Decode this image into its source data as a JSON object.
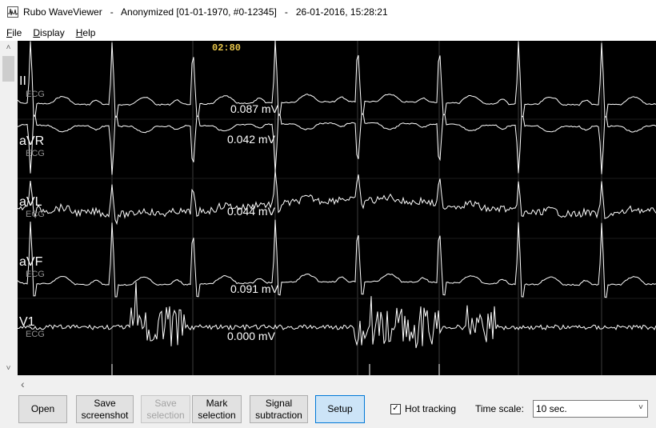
{
  "window": {
    "title": "Rubo WaveViewer   -   Anonymized [01-01-1970, #0-12345]   -   26-01-2016, 15:28:21"
  },
  "menu": {
    "items": [
      {
        "key": "F",
        "rest": "ile"
      },
      {
        "key": "D",
        "rest": "isplay"
      },
      {
        "key": "H",
        "rest": "elp"
      }
    ]
  },
  "plot": {
    "time_label": "02:80",
    "leads": [
      {
        "name": "II",
        "type": "ECG",
        "value": "0.087 mV"
      },
      {
        "name": "aVR",
        "type": "ECG",
        "value": "0.042 mV"
      },
      {
        "name": "aVL",
        "type": "ECG",
        "value": "0.044 mV"
      },
      {
        "name": "aVF",
        "type": "ECG",
        "value": "0.091 mV"
      },
      {
        "name": "V1",
        "type": "ECG",
        "value": "0.000 mV"
      }
    ],
    "colors": {
      "background": "#000000",
      "trace": "#ffffff",
      "grid": "#3c3c3c",
      "time_label": "#e8c64a"
    }
  },
  "toolbar": {
    "open": "Open",
    "save_screenshot": "Save\nscreenshot",
    "save_selection": "Save\nselection",
    "mark_selection": "Mark\nselection",
    "signal_subtraction": "Signal\nsubtraction",
    "setup": "Setup",
    "hot_tracking_label": "Hot tracking",
    "hot_tracking_checked": true,
    "time_scale_label": "Time scale:",
    "time_scale_value": "10 sec."
  },
  "icons": {
    "app": "waveform-app-icon",
    "scroll_up": "chevron-up-icon",
    "scroll_down": "chevron-down-icon",
    "scroll_left": "chevron-left-icon",
    "select_dropdown": "chevron-down-icon"
  }
}
